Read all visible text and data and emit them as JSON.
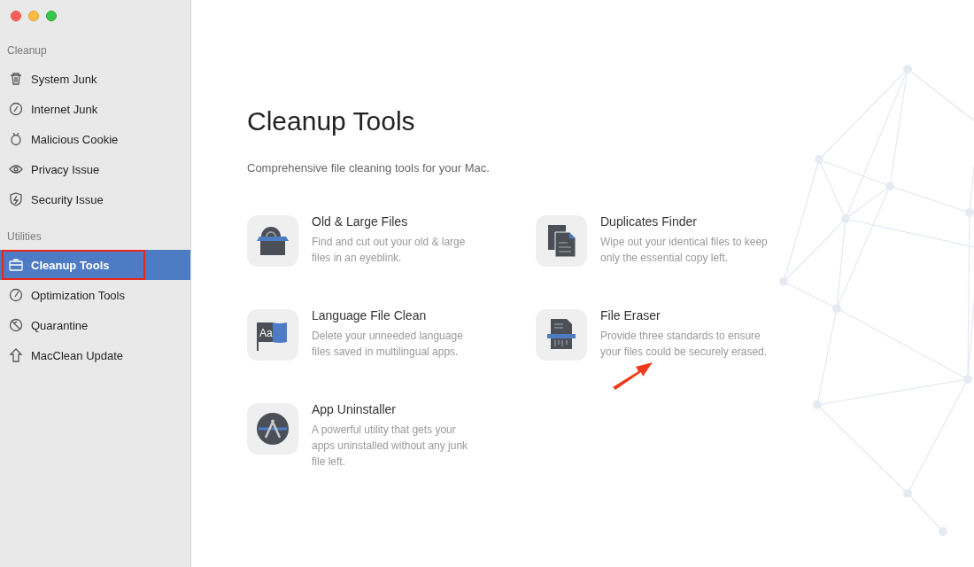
{
  "sidebar": {
    "sections": [
      {
        "label": "Cleanup",
        "items": [
          {
            "label": "System Junk",
            "selected": false,
            "annotated": false
          },
          {
            "label": "Internet Junk",
            "selected": false,
            "annotated": false
          },
          {
            "label": "Malicious Cookie",
            "selected": false,
            "annotated": false
          },
          {
            "label": "Privacy Issue",
            "selected": false,
            "annotated": false
          },
          {
            "label": "Security Issue",
            "selected": false,
            "annotated": false
          }
        ]
      },
      {
        "label": "Utilities",
        "items": [
          {
            "label": "Cleanup Tools",
            "selected": true,
            "annotated": true
          },
          {
            "label": "Optimization Tools",
            "selected": false,
            "annotated": false
          },
          {
            "label": "Quarantine",
            "selected": false,
            "annotated": false
          },
          {
            "label": "MacClean Update",
            "selected": false,
            "annotated": false
          }
        ]
      }
    ]
  },
  "main": {
    "title": "Cleanup Tools",
    "subtitle": "Comprehensive file cleaning tools for your Mac.",
    "tools": [
      {
        "name": "Old & Large Files",
        "description": "Find and cut out your old & large files in an eyeblink.",
        "annotated": false
      },
      {
        "name": "Duplicates Finder",
        "description": "Wipe out your identical files to keep only the essential copy left.",
        "annotated": false
      },
      {
        "name": "Language File Clean",
        "description": "Delete your unneeded language files saved in multilingual apps.",
        "icon_text": "Aa",
        "annotated": false
      },
      {
        "name": "File Eraser",
        "description": "Provide three standards to ensure your files could be securely erased.",
        "annotated": true
      },
      {
        "name": "App Uninstaller",
        "description": "A powerful utility that gets your apps uninstalled without any junk file left.",
        "annotated": false
      }
    ]
  }
}
